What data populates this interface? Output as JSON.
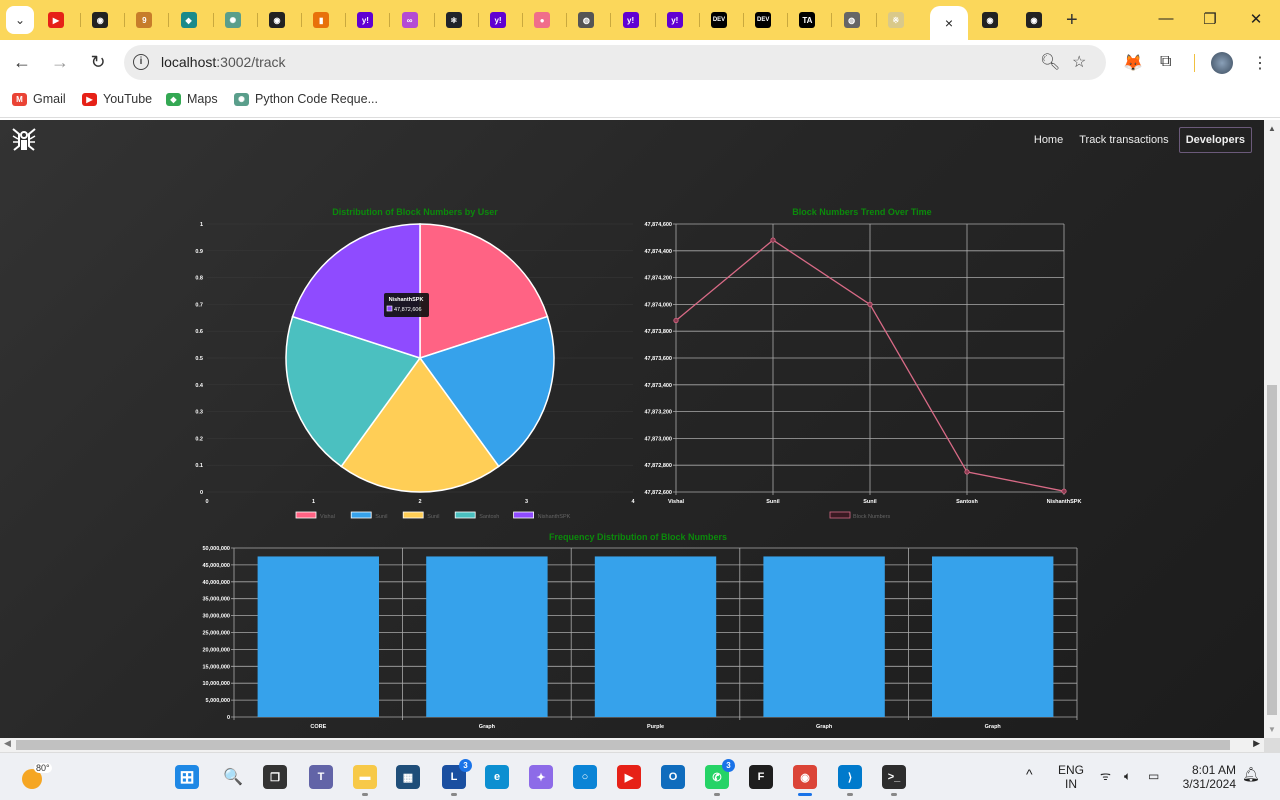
{
  "browser": {
    "tabs": [
      {
        "icon": "youtube-icon",
        "color": "#e62117",
        "glyph": "▶"
      },
      {
        "icon": "github-icon",
        "color": "#222222",
        "glyph": "◉"
      },
      {
        "icon": "glitch-icon",
        "color": "#c77d2a",
        "glyph": "9"
      },
      {
        "icon": "globe-teal-icon",
        "color": "#1a8a8a",
        "glyph": "◆"
      },
      {
        "icon": "chatgpt-icon",
        "color": "#5a9e8b",
        "glyph": "✺"
      },
      {
        "icon": "github-icon",
        "color": "#222222",
        "glyph": "◉"
      },
      {
        "icon": "analytics-icon",
        "color": "#e8710a",
        "glyph": "▮"
      },
      {
        "icon": "yahoo-icon",
        "color": "#6001d2",
        "glyph": "y!"
      },
      {
        "icon": "polygon-icon",
        "color": "#b44bd4",
        "glyph": "∞"
      },
      {
        "icon": "react-icon",
        "color": "#20232a",
        "glyph": "⚛"
      },
      {
        "icon": "yahoo-icon",
        "color": "#6001d2",
        "glyph": "y!"
      },
      {
        "icon": "cake-icon",
        "color": "#f06e8a",
        "glyph": "●"
      },
      {
        "icon": "globe-icon",
        "color": "#555555",
        "glyph": "◍"
      },
      {
        "icon": "yahoo-icon",
        "color": "#6001d2",
        "glyph": "y!"
      },
      {
        "icon": "yahoo-icon",
        "color": "#6001d2",
        "glyph": "y!"
      },
      {
        "icon": "dev-icon",
        "color": "#000000",
        "glyph": "DEV"
      },
      {
        "icon": "dev-icon",
        "color": "#000000",
        "glyph": "DEV"
      },
      {
        "icon": "ta-icon",
        "color": "#000000",
        "glyph": "TA"
      },
      {
        "icon": "globe-icon",
        "color": "#666666",
        "glyph": "◍"
      },
      {
        "icon": "app-logo-icon",
        "color": "#d9c98a",
        "glyph": "※"
      }
    ],
    "after_tabs": [
      {
        "icon": "github-icon",
        "color": "#222222",
        "glyph": "◉"
      },
      {
        "icon": "github-icon",
        "color": "#222222",
        "glyph": "◉"
      }
    ],
    "active_tab_close": "×",
    "new_tab": "+",
    "url_host": "localhost",
    "url_path": ":3002/track",
    "bookmarks": [
      {
        "label": "Gmail",
        "icon": "gmail-icon",
        "color": "#ea4335",
        "glyph": "M"
      },
      {
        "label": "YouTube",
        "icon": "youtube-icon",
        "color": "#e62117",
        "glyph": "▶"
      },
      {
        "label": "Maps",
        "icon": "maps-icon",
        "color": "#34a853",
        "glyph": "◆"
      },
      {
        "label": "Python Code Reque...",
        "icon": "chatgpt-icon",
        "color": "#5a9e8b",
        "glyph": "✺"
      }
    ]
  },
  "site": {
    "nav": [
      {
        "label": "Home",
        "active": false
      },
      {
        "label": "Track transactions",
        "active": false
      },
      {
        "label": "Developers",
        "active": true
      }
    ]
  },
  "colors": {
    "title_green": "#0b8a0b",
    "pink": "#ff6384",
    "blue": "#36a2eb",
    "yellow": "#ffce56",
    "teal": "#4bc0c0",
    "purple": "#9966ff",
    "line_pink": "#d86a86"
  },
  "chart_data": [
    {
      "type": "pie",
      "title": "Distribution of Block Numbers by User",
      "labels": [
        "Vishal",
        "Sunil",
        "Sunil",
        "Santosh",
        "NishanthSPK"
      ],
      "values": [
        47873880,
        47874480,
        47874000,
        47872750,
        47872606
      ],
      "colors": [
        "#ff6384",
        "#36a2eb",
        "#ffce56",
        "#4bc0c0",
        "#8f4bff"
      ],
      "x_ticks": [
        "0",
        "1",
        "2",
        "3",
        "4"
      ],
      "y_ticks": [
        "0",
        "0.1",
        "0.2",
        "0.3",
        "0.4",
        "0.5",
        "0.6",
        "0.7",
        "0.8",
        "0.9",
        "1"
      ],
      "tooltip": {
        "label": "NishanthSPK",
        "value": "47,872,606"
      },
      "legend": "bottom"
    },
    {
      "type": "line",
      "title": "Block Numbers Trend Over Time",
      "categories": [
        "Vishal",
        "Sunil",
        "Sunil",
        "Santosh",
        "NishanthSPK"
      ],
      "series": [
        {
          "name": "Block Numbers",
          "values": [
            47873880,
            47874480,
            47874000,
            47872750,
            47872606
          ]
        }
      ],
      "ylim": [
        47872600,
        47874600
      ],
      "y_ticks": [
        "47,872,600",
        "47,872,800",
        "47,873,000",
        "47,873,200",
        "47,873,400",
        "47,873,600",
        "47,873,800",
        "47,874,000",
        "47,874,200",
        "47,874,400",
        "47,874,600"
      ],
      "grid": true,
      "legend": "bottom"
    },
    {
      "type": "bar",
      "title": "Frequency Distribution of Block Numbers",
      "categories": [
        "CORE",
        "Graph",
        "Purple",
        "Graph",
        "Graph"
      ],
      "values": [
        47500000,
        47500000,
        47500000,
        47500000,
        47500000
      ],
      "ylim": [
        0,
        50000000
      ],
      "y_ticks": [
        "0",
        "5,000,000",
        "10,000,000",
        "15,000,000",
        "20,000,000",
        "25,000,000",
        "30,000,000",
        "35,000,000",
        "40,000,000",
        "45,000,000",
        "50,000,000"
      ],
      "grid": true
    }
  ],
  "taskbar": {
    "weather_temp": "80°",
    "apps": [
      {
        "name": "start",
        "color": "#1e88e5",
        "glyph": "⊞"
      },
      {
        "name": "search",
        "color": "transparent",
        "glyph": "🔍"
      },
      {
        "name": "task-view",
        "color": "#333333",
        "glyph": "❐"
      },
      {
        "name": "teams",
        "color": "#6264a7",
        "glyph": "T"
      },
      {
        "name": "file-explorer",
        "color": "#f7c948",
        "glyph": "▬"
      },
      {
        "name": "store",
        "color": "#1f4e79",
        "glyph": "▦"
      },
      {
        "name": "l-app",
        "color": "#1a4fa0",
        "glyph": "L",
        "badge": "3"
      },
      {
        "name": "edge",
        "color": "#0c8fd1",
        "glyph": "e"
      },
      {
        "name": "copilot",
        "color": "#8d6be8",
        "glyph": "✦"
      },
      {
        "name": "cortana",
        "color": "#0a84d6",
        "glyph": "○"
      },
      {
        "name": "youtube",
        "color": "#e62117",
        "glyph": "▶"
      },
      {
        "name": "outlook",
        "color": "#0f6cbd",
        "glyph": "O"
      },
      {
        "name": "whatsapp",
        "color": "#25d366",
        "glyph": "✆",
        "badge": "3"
      },
      {
        "name": "figma",
        "color": "#1e1e1e",
        "glyph": "F"
      },
      {
        "name": "chrome",
        "color": "#db4437",
        "glyph": "◉"
      },
      {
        "name": "vscode",
        "color": "#007acc",
        "glyph": "⟩"
      },
      {
        "name": "terminal",
        "color": "#2d2d2d",
        "glyph": ">_"
      }
    ],
    "lang_top": "ENG",
    "lang_bottom": "IN",
    "time": "8:01 AM",
    "date": "3/31/2024"
  }
}
